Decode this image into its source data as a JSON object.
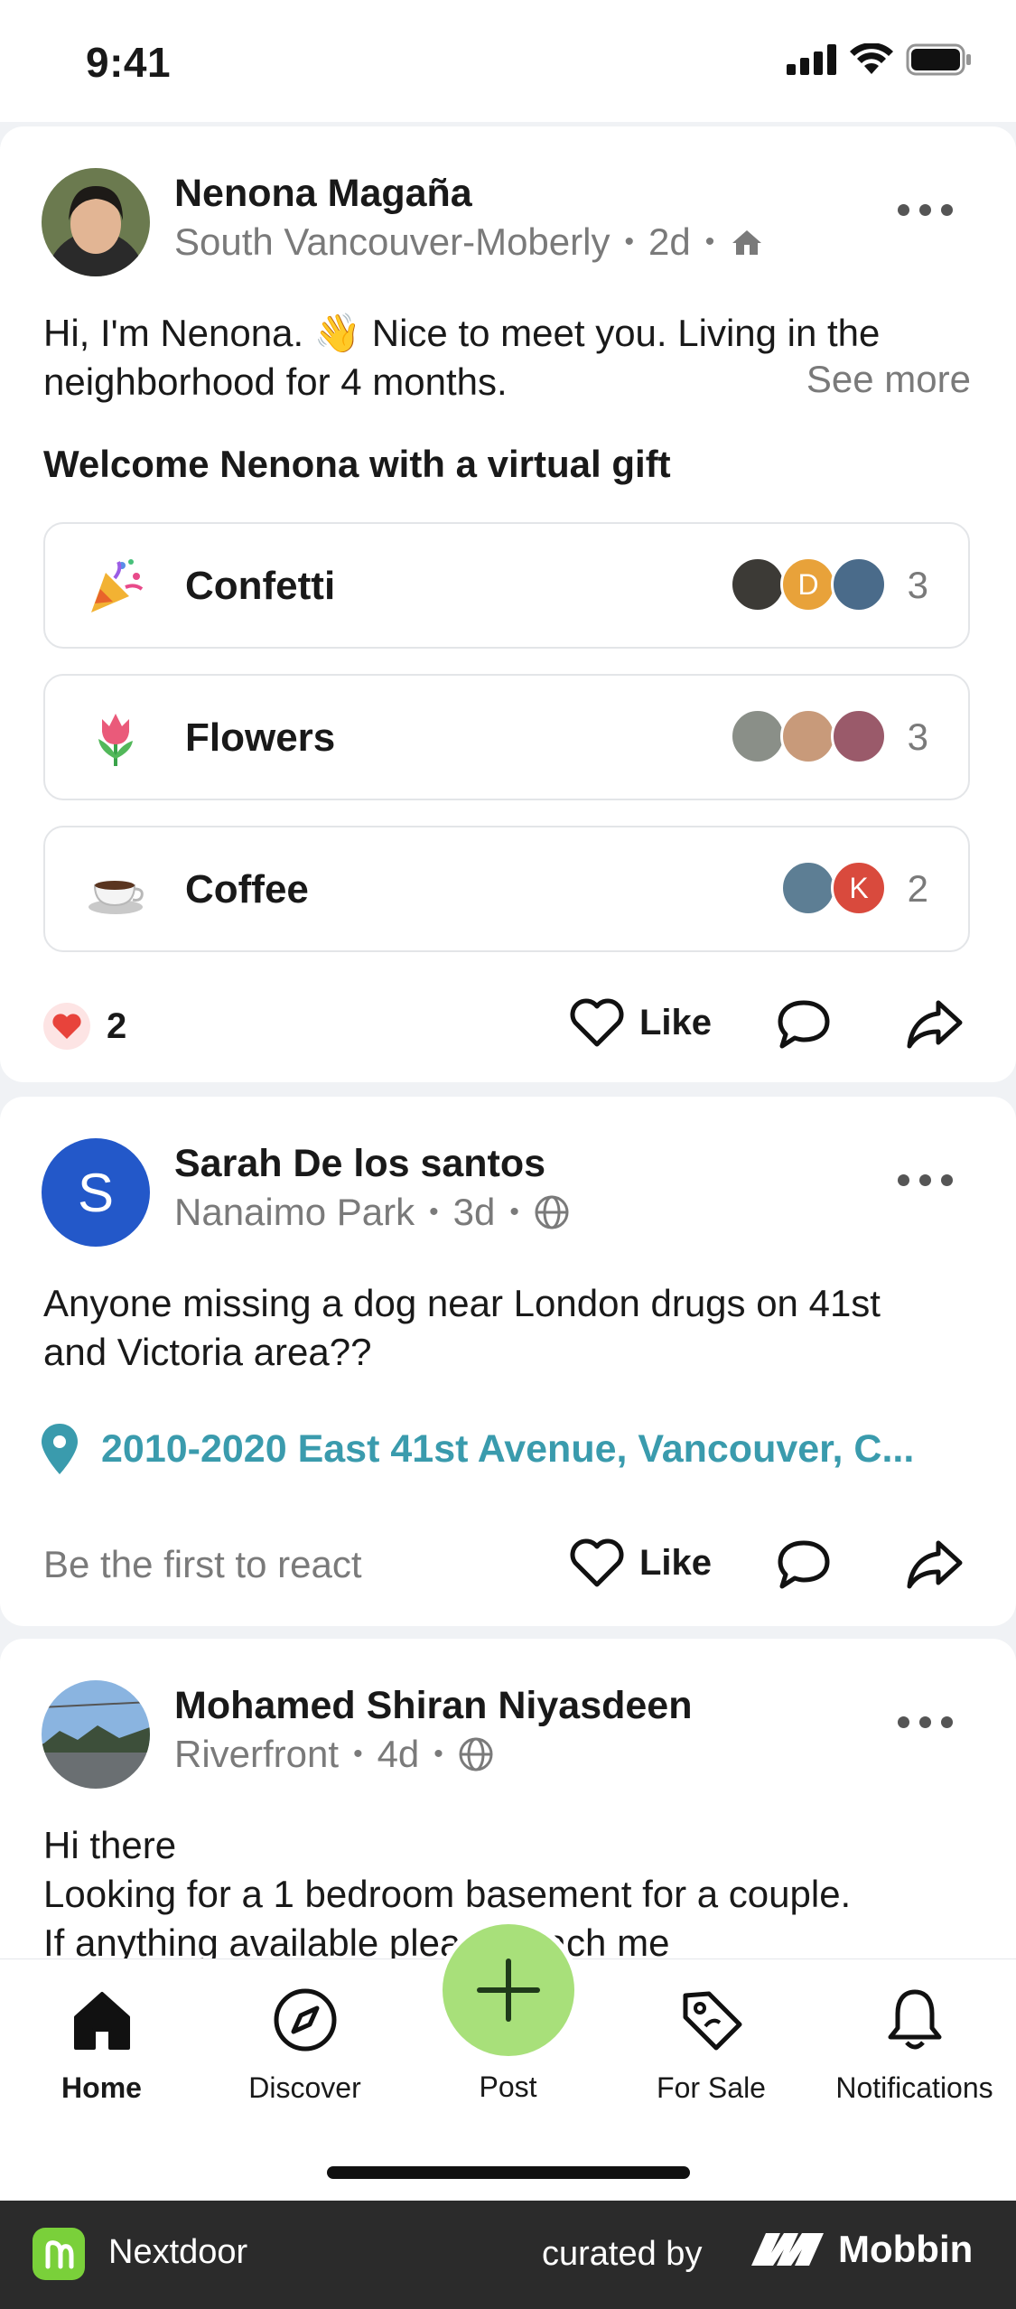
{
  "status": {
    "time": "9:41"
  },
  "posts": [
    {
      "author": "Nenona Magaña",
      "neighborhood": "South Vancouver-Moberly",
      "age": "2d",
      "body_line1": "Hi, I'm Nenona. 👋 Nice to meet you. Living in the",
      "body_line2": "neighborhood for 4 months.",
      "see_more": "See more",
      "gift_title": "Welcome Nenona with a virtual gift",
      "gifts": [
        {
          "label": "Confetti",
          "count": "3",
          "icon": "party-popper-icon"
        },
        {
          "label": "Flowers",
          "count": "3",
          "icon": "tulip-icon"
        },
        {
          "label": "Coffee",
          "count": "2",
          "icon": "coffee-cup-icon"
        }
      ],
      "gift_avatar_initials": [
        "D",
        "K"
      ],
      "reaction_count": "2",
      "like_label": "Like"
    },
    {
      "author": "Sarah De los santos",
      "avatar_initial": "S",
      "neighborhood": "Nanaimo Park",
      "age": "3d",
      "body_line1": "Anyone missing a dog near London drugs on 41st",
      "body_line2": "and Victoria area??",
      "location": "2010-2020 East 41st Avenue, Vancouver, C...",
      "first_react": "Be the first to react",
      "like_label": "Like"
    },
    {
      "author": "Mohamed Shiran Niyasdeen",
      "neighborhood": "Riverfront",
      "age": "4d",
      "body_line1": "Hi there",
      "body_line2": "Looking for a 1 bedroom basement for a couple.",
      "body_line3": "If anything available please reach me"
    }
  ],
  "tabs": {
    "home": "Home",
    "discover": "Discover",
    "post": "Post",
    "for_sale": "For Sale",
    "notifications": "Notifications"
  },
  "footer": {
    "brand": "Nextdoor",
    "curated": "curated by",
    "mobbin": "Mobbin"
  },
  "colors": {
    "accent_teal": "#3a9bad",
    "post_fab_green": "#a8e07a",
    "nextdoor_green": "#7ad03a",
    "avatar_blue": "#2358c9",
    "avatar_orange": "#e8a23a",
    "avatar_red": "#d94a3d"
  }
}
